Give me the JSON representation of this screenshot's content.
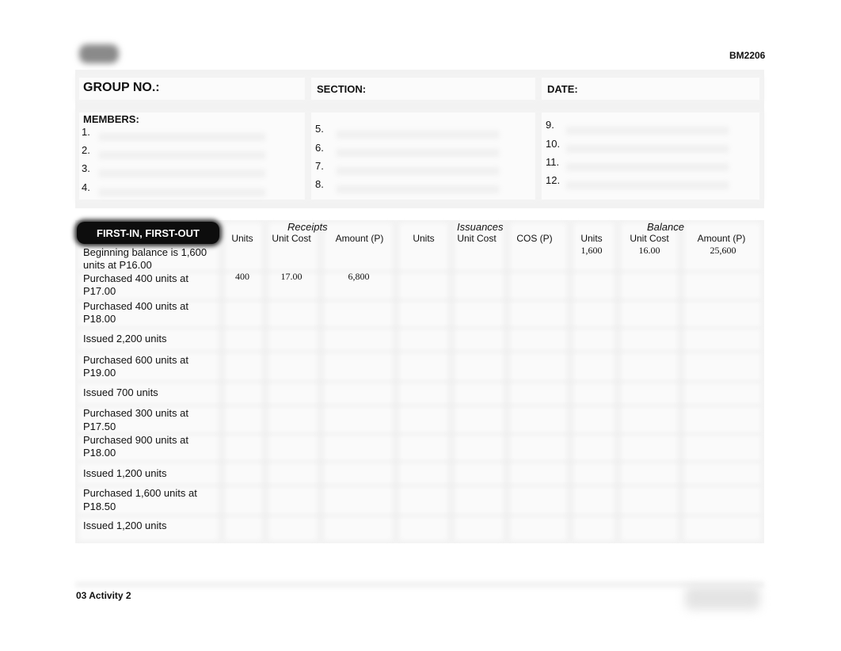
{
  "header": {
    "doc_code": "BM2206",
    "logo_icon": "blurred-logo-icon"
  },
  "form": {
    "group_label": "GROUP NO.:",
    "section_label": "SECTION:",
    "date_label": "DATE:",
    "members_label": "MEMBERS:",
    "group_value": "",
    "section_value": "",
    "date_value": "",
    "members": [
      {
        "num": "1.",
        "name": ""
      },
      {
        "num": "2.",
        "name": ""
      },
      {
        "num": "3.",
        "name": ""
      },
      {
        "num": "4.",
        "name": ""
      },
      {
        "num": "5.",
        "name": ""
      },
      {
        "num": "6.",
        "name": ""
      },
      {
        "num": "7.",
        "name": ""
      },
      {
        "num": "8.",
        "name": ""
      },
      {
        "num": "9.",
        "name": ""
      },
      {
        "num": "10.",
        "name": ""
      },
      {
        "num": "11.",
        "name": ""
      },
      {
        "num": "12.",
        "name": ""
      }
    ]
  },
  "table": {
    "method_label": "FIRST-IN, FIRST-OUT",
    "groups": {
      "receipts": "Receipts",
      "issuances": "Issuances",
      "balance": "Balance"
    },
    "columns": {
      "r_units": "Units",
      "r_unit_cost": "Unit Cost",
      "r_amount": "Amount (P)",
      "i_units": "Units",
      "i_unit_cost": "Unit Cost",
      "i_cos": "COS (P)",
      "b_units": "Units",
      "b_unit_cost": "Unit Cost",
      "b_amount": "Amount (P)"
    },
    "rows": [
      {
        "desc": "Beginning balance is 1,600 units at P16.00",
        "r_units": "",
        "r_unit_cost": "",
        "r_amount": "",
        "b_units": "1,600",
        "b_unit_cost": "16.00",
        "b_amount": "25,600"
      },
      {
        "desc": "Purchased 400 units at P17.00",
        "r_units": "400",
        "r_unit_cost": "17.00",
        "r_amount": "6,800",
        "b_units": "",
        "b_unit_cost": "",
        "b_amount": ""
      },
      {
        "desc": "Purchased 400 units at P18.00"
      },
      {
        "desc": "Issued 2,200 units"
      },
      {
        "desc": "Purchased 600 units at P19.00"
      },
      {
        "desc": "Issued 700 units"
      },
      {
        "desc": "Purchased 300 units at P17.50"
      },
      {
        "desc": "Purchased 900 units at P18.00"
      },
      {
        "desc": "Issued 1,200 units"
      },
      {
        "desc": "Purchased 1,600 units at P18.50"
      },
      {
        "desc": "Issued 1,200 units"
      }
    ]
  },
  "footer": {
    "activity_label": "03 Activity 2"
  }
}
